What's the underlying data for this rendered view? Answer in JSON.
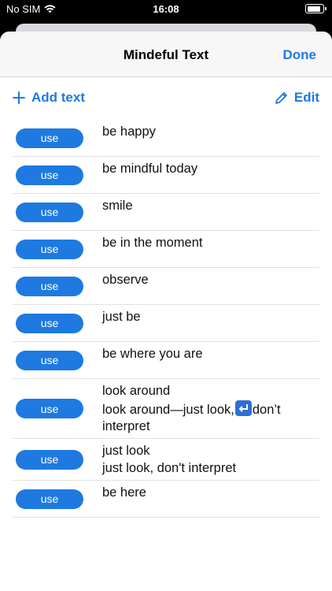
{
  "status_bar": {
    "carrier": "No SIM",
    "time": "16:08",
    "wifi_icon": "wifi-icon",
    "battery_icon": "battery-icon"
  },
  "nav": {
    "title": "Mindeful Text",
    "done_label": "Done"
  },
  "toolbar": {
    "add_label": "Add text",
    "add_icon": "plus-icon",
    "edit_label": "Edit",
    "edit_icon": "pencil-icon"
  },
  "items": [
    {
      "button": "use",
      "text": "be happy"
    },
    {
      "button": "use",
      "text": "be mindful today"
    },
    {
      "button": "use",
      "text": "smile"
    },
    {
      "button": "use",
      "text": "be in the moment"
    },
    {
      "button": "use",
      "text": "observe"
    },
    {
      "button": "use",
      "text": "just be"
    },
    {
      "button": "use",
      "text": "be where you are"
    },
    {
      "button": "use",
      "text_line1": "look around",
      "text_line2a": "look around—just look,",
      "text_line2_icon": "return-arrow-emoji",
      "text_line2b": "don’t",
      "text_line3": "interpret"
    },
    {
      "button": "use",
      "text": "just look\njust look, don't interpret"
    },
    {
      "button": "use",
      "text": "be here"
    }
  ],
  "colors": {
    "accent": "#1e7ae0",
    "nav_background": "#f7f7f7",
    "separator": "#e2e2e4"
  }
}
